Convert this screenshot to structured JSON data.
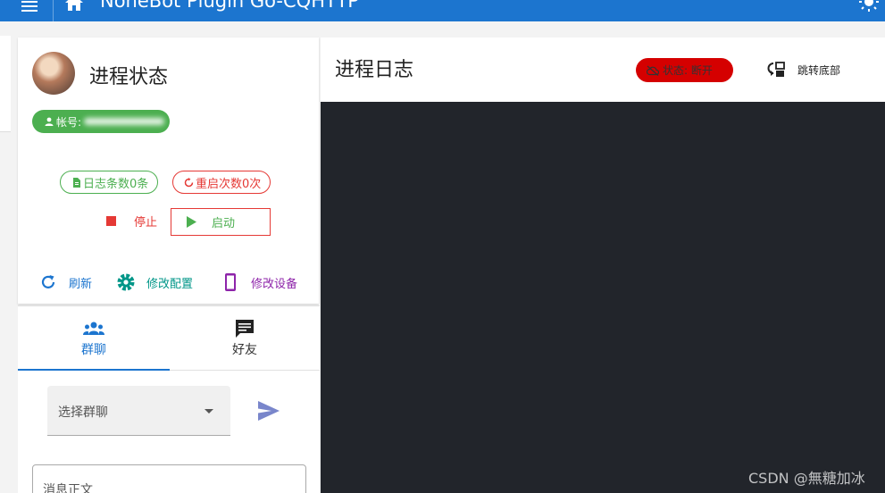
{
  "appbar": {
    "title": "NoneBot Plugin Go-CQHTTP"
  },
  "status": {
    "title": "进程状态",
    "account_label": "帐号:",
    "log_count": "日志条数0条",
    "restart_count": "重启次数0次",
    "stop_label": "停止",
    "start_label": "启动",
    "refresh_label": "刷新",
    "config_label": "修改配置",
    "device_label": "修改设备"
  },
  "chat": {
    "tab_group": "群聊",
    "tab_friend": "好友",
    "select_placeholder": "选择群聊",
    "message_placeholder": "消息正文"
  },
  "log": {
    "title": "进程日志",
    "state_label": "状态: 断开",
    "jump_label": "跳转底部"
  },
  "watermark": "CSDN @無糖加冰",
  "colors": {
    "primary": "#1c75cf",
    "success": "#4caf50",
    "danger": "#e53935",
    "teal": "#009688",
    "purple": "#8e24aa",
    "log_bg": "#22252b"
  }
}
